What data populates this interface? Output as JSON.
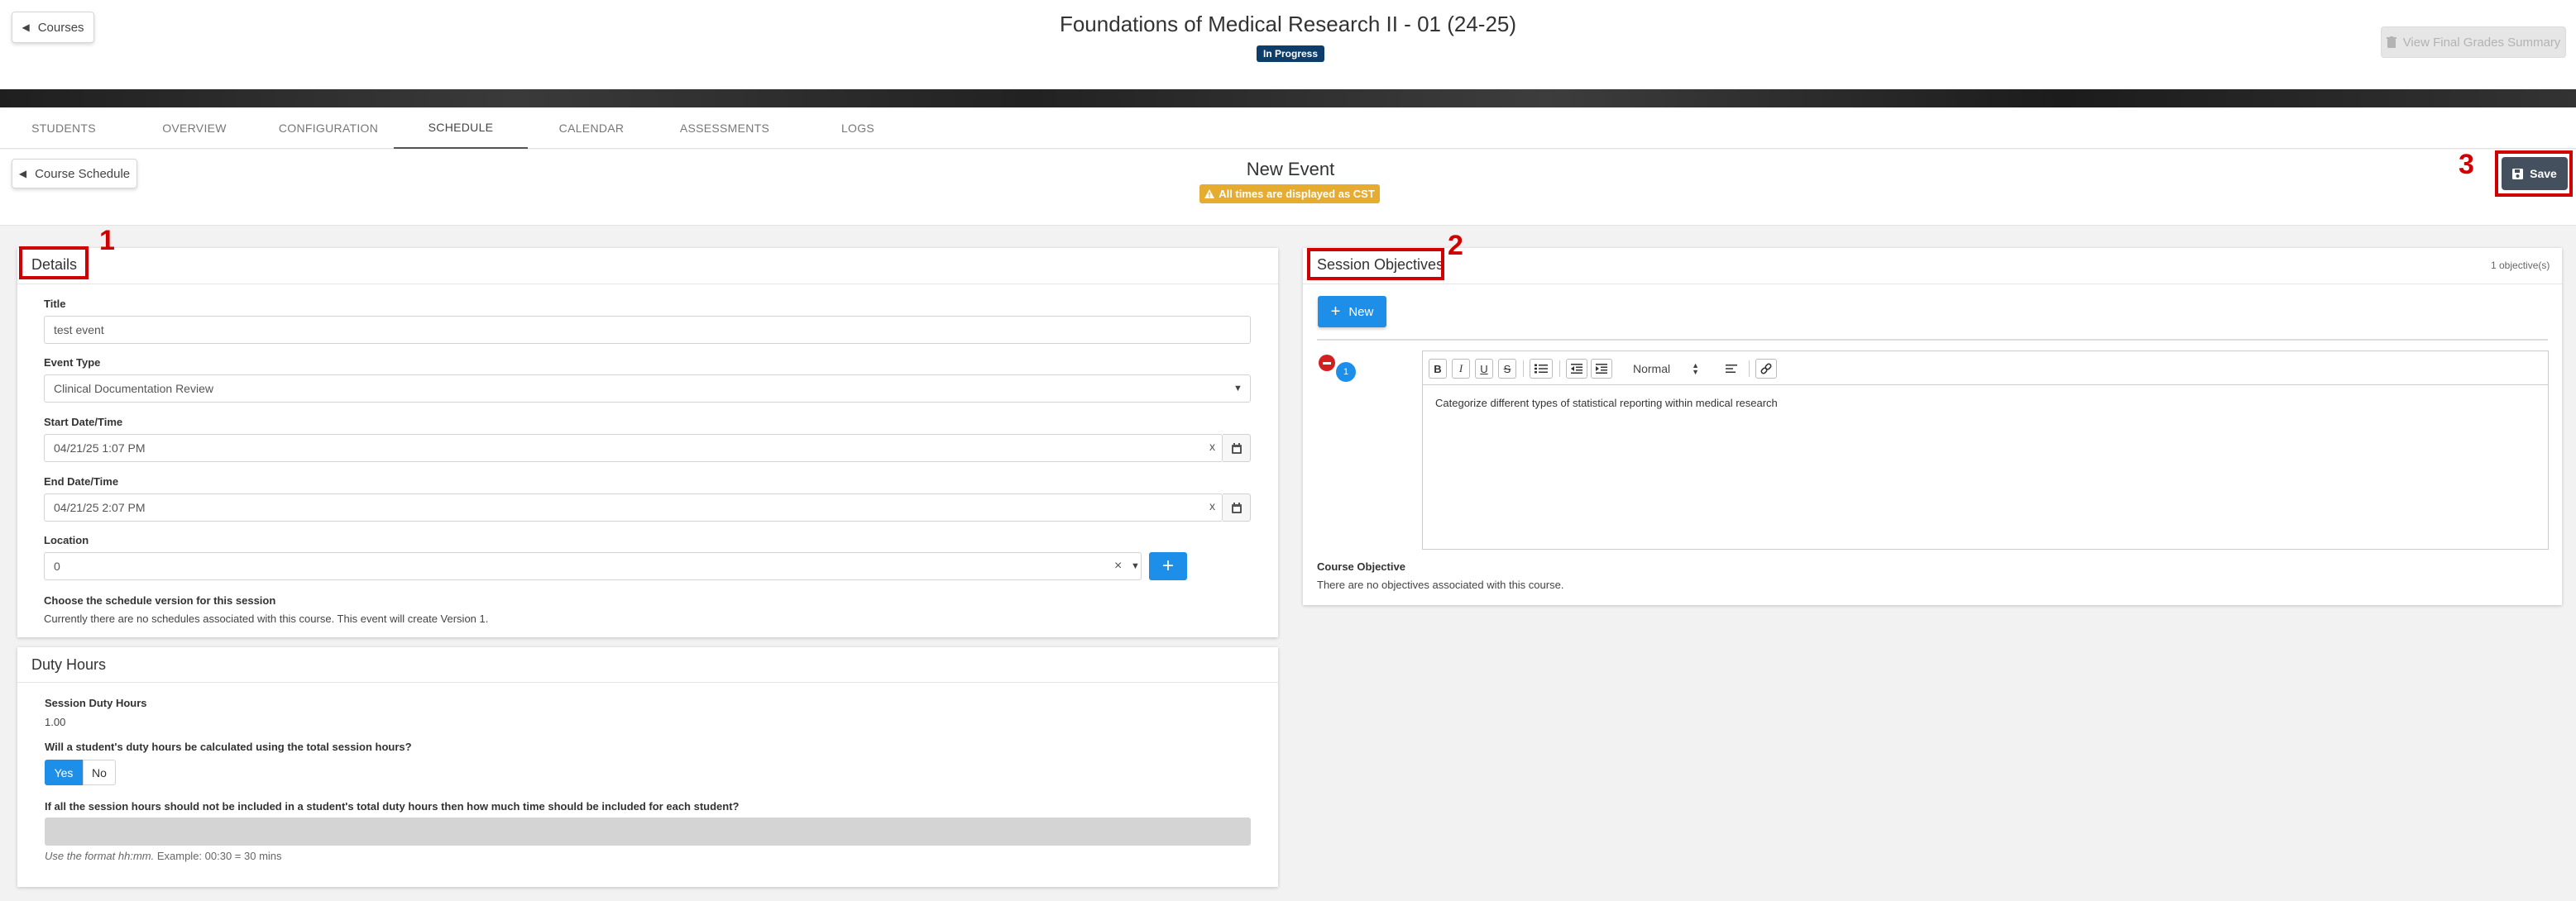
{
  "header": {
    "back_label": "Courses",
    "course_title": "Foundations of Medical Research II - 01 (24-25)",
    "status": "In Progress",
    "final_grades_label": "View Final Grades Summary"
  },
  "tabs": [
    {
      "label": "STUDENTS"
    },
    {
      "label": "OVERVIEW"
    },
    {
      "label": "CONFIGURATION"
    },
    {
      "label": "SCHEDULE",
      "active": true
    },
    {
      "label": "CALENDAR"
    },
    {
      "label": "ASSESSMENTS"
    },
    {
      "label": "LOGS"
    }
  ],
  "subheader": {
    "back_label": "Course Schedule",
    "title": "New Event",
    "timezone_notice": "All times are displayed as CST",
    "save_label": "Save"
  },
  "annotations": [
    "1",
    "2",
    "3"
  ],
  "details": {
    "title": "Details",
    "title_label": "Title",
    "title_value": "test event",
    "event_type_label": "Event Type",
    "event_type_value": "Clinical Documentation Review",
    "start_label": "Start Date/Time",
    "start_value": "04/21/25 1:07 PM",
    "end_label": "End Date/Time",
    "end_value": "04/21/25 2:07 PM",
    "location_label": "Location",
    "location_value": "0",
    "clear_symbol": "x",
    "location_clear_symbol": "×",
    "schedule_version_label": "Choose the schedule version for this session",
    "schedule_version_text": "Currently there are no schedules associated with this course. This event will create Version 1."
  },
  "duty_hours": {
    "title": "Duty Hours",
    "session_label": "Session Duty Hours",
    "session_value": "1.00",
    "question": "Will a student's duty hours be calculated using the total session hours?",
    "yes_label": "Yes",
    "no_label": "No",
    "partial_question": "If all the session hours should not be included in a student's total duty hours then how much time should be included for each student?",
    "hint_italic": "Use the format hh:mm.",
    "hint_example": "Example: 00:30 = 30 mins"
  },
  "objectives": {
    "title": "Session Objectives",
    "count": "1 objective(s)",
    "new_label": "New",
    "item_number": "1",
    "editor_style": "Normal",
    "editor_content": "Categorize different types of statistical reporting within medical research",
    "course_objective_label": "Course Objective",
    "course_objective_text": "There are no objectives associated with this course."
  },
  "colors": {
    "primary": "#1e8fe8",
    "status_badge": "#0d3d6b",
    "warning": "#e6ac30",
    "save": "#45505e",
    "annotation": "#d00000"
  }
}
